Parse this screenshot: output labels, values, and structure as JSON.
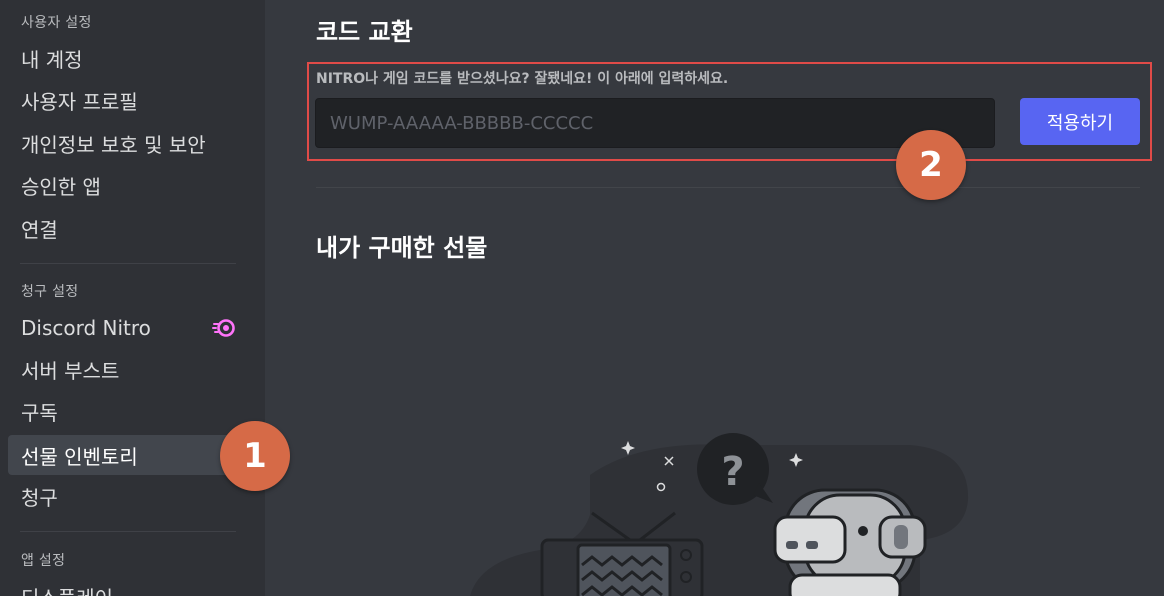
{
  "sidebar": {
    "user_settings_header": "사용자 설정",
    "user_items": [
      {
        "label": "내 계정"
      },
      {
        "label": "사용자 프로필"
      },
      {
        "label": "개인정보 보호 및 보안"
      },
      {
        "label": "승인한 앱"
      },
      {
        "label": "연결"
      }
    ],
    "billing_header": "청구 설정",
    "billing_items": [
      {
        "label": "Discord Nitro",
        "icon": "nitro-icon"
      },
      {
        "label": "서버 부스트"
      },
      {
        "label": "구독"
      },
      {
        "label": "선물 인벤토리",
        "selected": true
      },
      {
        "label": "청구"
      }
    ],
    "app_settings_header": "앱 설정",
    "app_items": [
      {
        "label": "디스플레이"
      }
    ]
  },
  "main": {
    "redeem_title": "코드 교환",
    "redeem_label": "NITRO나 게임 코드를 받으셨나요? 잘됐네요! 이 아래에 입력하세요.",
    "code_input": {
      "value": "",
      "placeholder": "WUMP-AAAAA-BBBBB-CCCCC"
    },
    "apply_button": "적용하기",
    "purchased_title": "내가 구매한 선물"
  },
  "annotations": {
    "step1": "1",
    "step2": "2"
  },
  "colors": {
    "accent": "#5865f2",
    "highlight": "#e04b48",
    "badge": "#d66a47",
    "nitro": "#ff73fa"
  }
}
